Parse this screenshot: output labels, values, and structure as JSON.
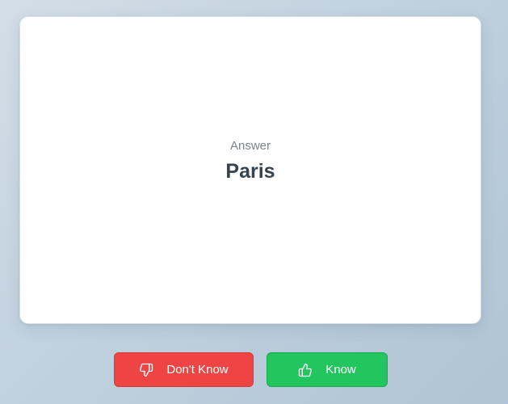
{
  "card": {
    "label": "Answer",
    "answer": "Paris"
  },
  "actions": {
    "dont_know_label": "Don't Know",
    "dont_know_icon": "thumbs-down-icon",
    "know_label": "Know",
    "know_icon": "thumbs-up-icon"
  },
  "colors": {
    "dont_know": "#ef4444",
    "know": "#22c55e",
    "answer_text": "#36434f",
    "label_text": "#7b838c"
  }
}
